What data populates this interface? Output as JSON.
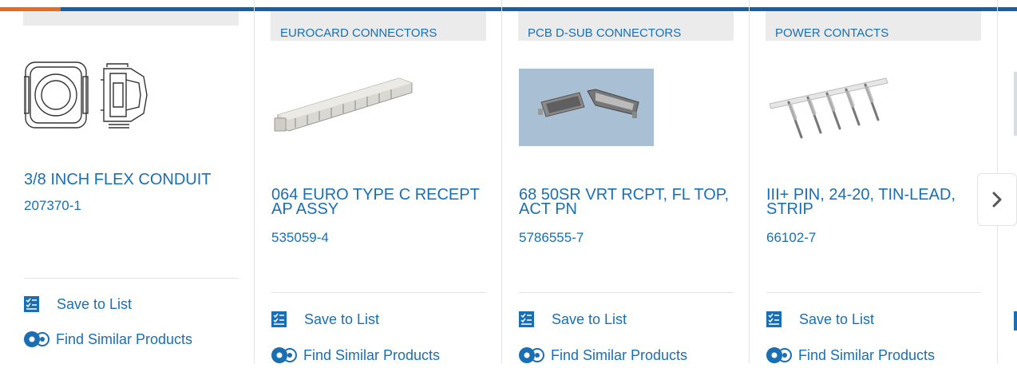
{
  "cards": [
    {
      "category": "",
      "title": "3/8 INCH FLEX CONDUIT",
      "part_number": "207370-1",
      "save_label": "Save to List",
      "similar_label": "Find Similar Products"
    },
    {
      "category": "EUROCARD CONNECTORS",
      "title": "064 EURO TYPE C RECEPT AP ASSY",
      "part_number": "535059-4",
      "save_label": "Save to List",
      "similar_label": "Find Similar Products"
    },
    {
      "category": "PCB D-SUB CONNECTORS",
      "title": "68 50SR VRT RCPT, FL TOP, ACT PN",
      "part_number": "5786555-7",
      "save_label": "Save to List",
      "similar_label": "Find Similar Products"
    },
    {
      "category": "POWER CONTACTS",
      "title": "III+ PIN, 24-20, TIN-LEAD, STRIP",
      "part_number": "66102-7",
      "save_label": "Save to List",
      "similar_label": "Find Similar Products"
    }
  ],
  "carousel": {
    "next_icon": "chevron-right-icon"
  },
  "colors": {
    "accent": "#1a6fb3",
    "brand_bar": "#1560a0",
    "highlight": "#e86a1a"
  }
}
